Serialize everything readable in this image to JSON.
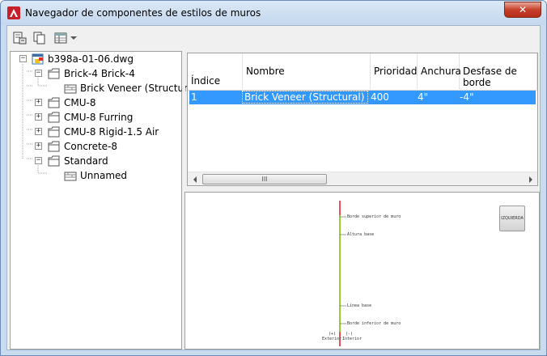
{
  "window": {
    "title": "Navegador de componentes de estilos de muros",
    "close_symbol": "✕"
  },
  "toolbar": {
    "icons": [
      "new-wall-style-icon",
      "copy-icon",
      "table-view-icon",
      "dropdown-arrow-icon"
    ]
  },
  "tree": {
    "root": {
      "label": "b398a-01-06.dwg",
      "expander": "−"
    },
    "items": [
      {
        "label": "Brick-4 Brick-4",
        "expander": "−"
      },
      {
        "label": "Brick Veneer (Structural)"
      },
      {
        "label": "CMU-8",
        "expander": "+"
      },
      {
        "label": "CMU-8 Furring",
        "expander": "+"
      },
      {
        "label": "CMU-8 Rigid-1.5 Air",
        "expander": "+"
      },
      {
        "label": "Concrete-8",
        "expander": "+"
      },
      {
        "label": "Standard",
        "expander": "−"
      },
      {
        "label": "Unnamed"
      }
    ]
  },
  "grid": {
    "columns": [
      "Índice",
      "Nombre",
      "Prioridad",
      "Anchura",
      "Desfase de borde"
    ],
    "rows": [
      {
        "index": "1",
        "name": "Brick Veneer (Structural)",
        "priority": "400",
        "width": "4\"",
        "offset": "-4\""
      }
    ],
    "scroll_thumb_glyph": "III"
  },
  "preview": {
    "button_label": "IZQUIERDA",
    "labels": {
      "top": "Borde superior de muro",
      "height": "Altura base",
      "baseline": "Línea base",
      "bottom": "Borde inferior de muro",
      "ext_sign": "(+)",
      "ext": "Exterior",
      "int_sign": "(-)",
      "int": "Interior"
    },
    "colors": {
      "red_line": "#e0141e",
      "green_line": "#9acd32"
    }
  },
  "colors": {
    "selection": "#3399ff",
    "window_frame": "#c9dcef",
    "close_button": "#c7402b"
  }
}
